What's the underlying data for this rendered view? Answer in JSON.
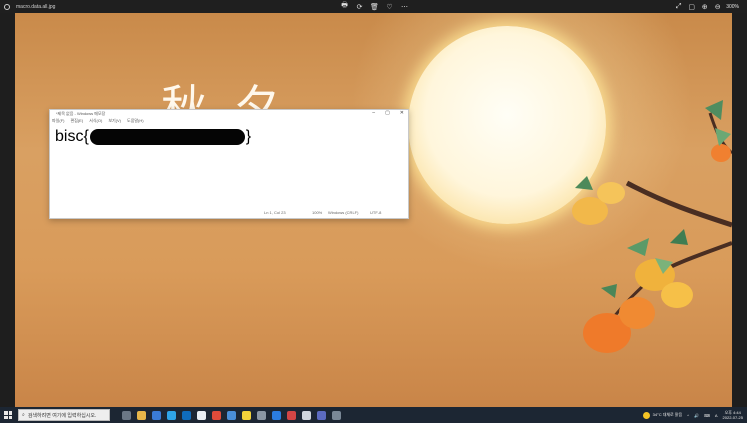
{
  "viewer": {
    "file_name": "macro.data.all.jpg",
    "zoom": "300%",
    "tool_icons": [
      "🖶",
      "⟳",
      "🗑",
      "♡",
      "⋯"
    ],
    "right_icons": [
      "⤢",
      "▢",
      "⊕",
      "⊖"
    ]
  },
  "poster": {
    "title": "秋 夕"
  },
  "notepad": {
    "title": "*제목 없음 - Windows 메모장",
    "menu": [
      "파일(F)",
      "편집(E)",
      "서식(O)",
      "보기(V)",
      "도움말(H)"
    ],
    "controls": [
      "–",
      "▢",
      "✕"
    ],
    "text_prefix": "bisc{",
    "text_suffix": "}",
    "status": {
      "position": "Ln 1, Col 23",
      "zoom": "100%",
      "line_ending": "Windows (CRLF)",
      "encoding": "UTF-8"
    }
  },
  "taskbar": {
    "search_placeholder": "검색하려면 여기에 입력하십시오.",
    "weather": "34°C 대체로 맑음",
    "time": "오후 4:44",
    "date": "2022-07-25",
    "tray_icons": [
      "^",
      "🔊",
      "⌨",
      "A"
    ]
  },
  "colors": {
    "taskbar_bg": "#1c2633",
    "viewer_bar_bg": "#1f1f1f",
    "accent": "#0078d4"
  }
}
